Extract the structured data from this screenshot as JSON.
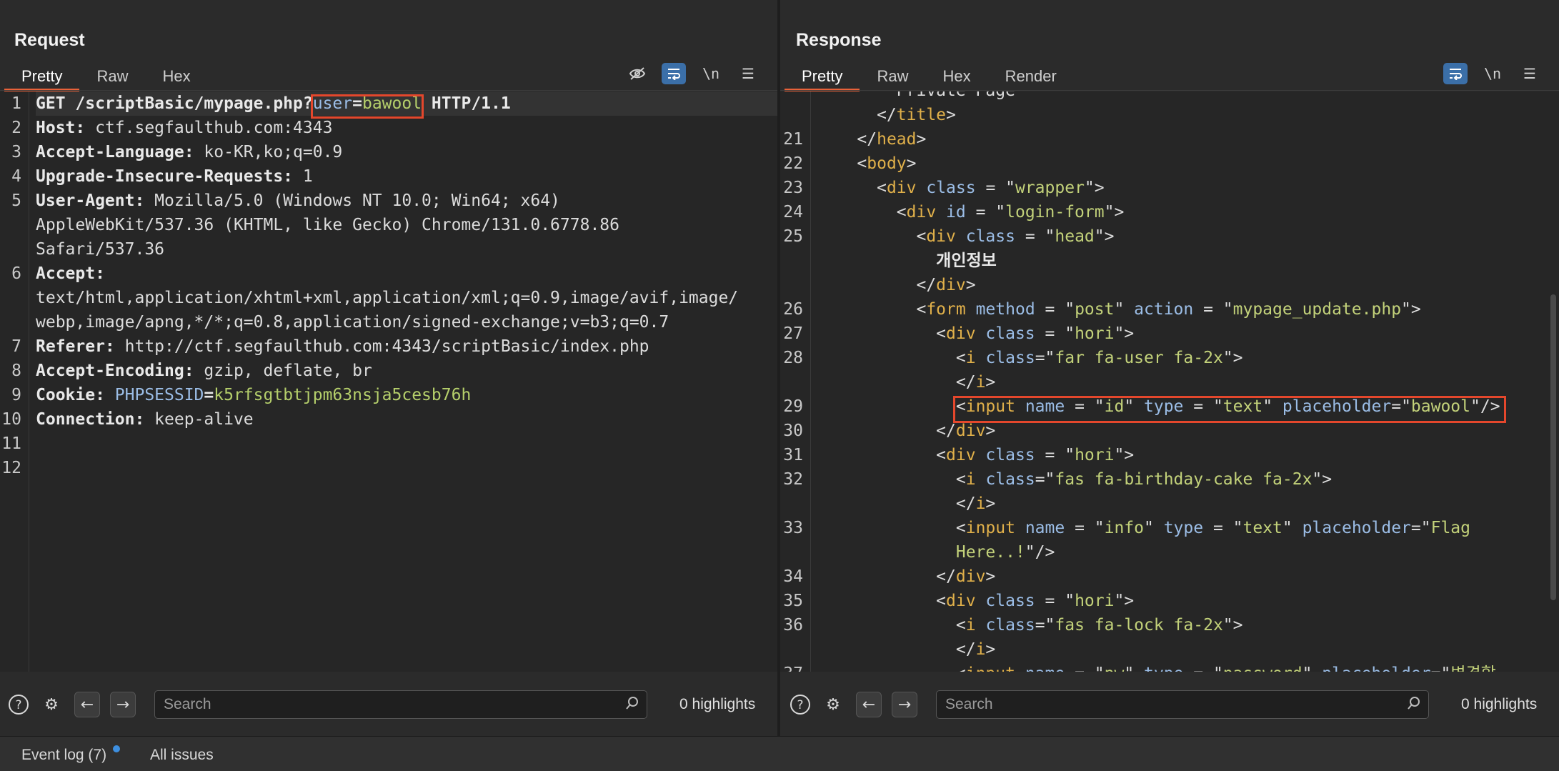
{
  "layout_buttons": [
    {
      "name": "split-horizontal",
      "active": true
    },
    {
      "name": "split-vertical",
      "active": false
    },
    {
      "name": "single-pane",
      "active": false
    }
  ],
  "request": {
    "title": "Request",
    "tabs": [
      "Pretty",
      "Raw",
      "Hex"
    ],
    "active_tab": "Pretty",
    "newline_label": "\\n",
    "lines": [
      {
        "n": "1",
        "segs": [
          [
            "k",
            "GET /scriptBasic/mypage.php?"
          ],
          [
            "p",
            "user"
          ],
          [
            "k",
            "="
          ],
          [
            "g",
            "bawool"
          ],
          [
            "k",
            " HTTP/1.1"
          ]
        ]
      },
      {
        "n": "2",
        "segs": [
          [
            "k",
            "Host: "
          ],
          [
            "",
            "ctf.segfaulthub.com:4343"
          ]
        ]
      },
      {
        "n": "3",
        "segs": [
          [
            "k",
            "Accept-Language: "
          ],
          [
            "",
            "ko-KR,ko;q=0.9"
          ]
        ]
      },
      {
        "n": "4",
        "segs": [
          [
            "k",
            "Upgrade-Insecure-Requests: "
          ],
          [
            "",
            "1"
          ]
        ]
      },
      {
        "n": "5",
        "segs": [
          [
            "k",
            "User-Agent: "
          ],
          [
            "",
            "Mozilla/5.0 (Windows NT 10.0; Win64; x64)"
          ]
        ]
      },
      {
        "n": "",
        "segs": [
          [
            "",
            "AppleWebKit/537.36 (KHTML, like Gecko) Chrome/131.0.6778.86"
          ]
        ]
      },
      {
        "n": "",
        "segs": [
          [
            "",
            "Safari/537.36"
          ]
        ]
      },
      {
        "n": "6",
        "segs": [
          [
            "k",
            "Accept:"
          ]
        ]
      },
      {
        "n": "",
        "segs": [
          [
            "",
            "text/html,application/xhtml+xml,application/xml;q=0.9,image/avif,image/"
          ]
        ]
      },
      {
        "n": "",
        "segs": [
          [
            "",
            "webp,image/apng,*/*;q=0.8,application/signed-exchange;v=b3;q=0.7"
          ]
        ]
      },
      {
        "n": "7",
        "segs": [
          [
            "k",
            "Referer: "
          ],
          [
            "",
            "http://ctf.segfaulthub.com:4343/scriptBasic/index.php"
          ]
        ]
      },
      {
        "n": "8",
        "segs": [
          [
            "k",
            "Accept-Encoding: "
          ],
          [
            "",
            "gzip, deflate, br"
          ]
        ]
      },
      {
        "n": "9",
        "segs": [
          [
            "k",
            "Cookie: "
          ],
          [
            "p",
            "PHPSESSID"
          ],
          [
            "k",
            "="
          ],
          [
            "g",
            "k5rfsgtbtjpm63nsja5cesb76h"
          ]
        ]
      },
      {
        "n": "10",
        "segs": [
          [
            "k",
            "Connection: "
          ],
          [
            "",
            "keep-alive"
          ]
        ]
      },
      {
        "n": "11",
        "segs": []
      },
      {
        "n": "12",
        "segs": []
      }
    ],
    "search_placeholder": "Search",
    "highlights": "0 highlights"
  },
  "response": {
    "title": "Response",
    "tabs": [
      "Pretty",
      "Raw",
      "Hex",
      "Render"
    ],
    "active_tab": "Pretty",
    "newline_label": "\\n",
    "lines": [
      {
        "n": "",
        "segs": [
          [
            "",
            "        Private Page"
          ]
        ]
      },
      {
        "n": "",
        "segs": [
          [
            "",
            "      </"
          ],
          [
            "t",
            "title"
          ],
          [
            "",
            ">"
          ]
        ]
      },
      {
        "n": "21",
        "segs": [
          [
            "",
            "    </"
          ],
          [
            "t",
            "head"
          ],
          [
            "",
            ">"
          ]
        ]
      },
      {
        "n": "22",
        "segs": [
          [
            "",
            "    <"
          ],
          [
            "t",
            "body"
          ],
          [
            "",
            ">"
          ]
        ]
      },
      {
        "n": "23",
        "segs": [
          [
            "",
            "      <"
          ],
          [
            "t",
            "div"
          ],
          [
            "",
            " "
          ],
          [
            "a",
            "class"
          ],
          [
            "",
            " = \""
          ],
          [
            "s",
            "wrapper"
          ],
          [
            "",
            "\">"
          ]
        ]
      },
      {
        "n": "24",
        "segs": [
          [
            "",
            "        <"
          ],
          [
            "t",
            "div"
          ],
          [
            "",
            " "
          ],
          [
            "a",
            "id"
          ],
          [
            "",
            " = \""
          ],
          [
            "s",
            "login-form"
          ],
          [
            "",
            "\">"
          ]
        ]
      },
      {
        "n": "25",
        "segs": [
          [
            "",
            "          <"
          ],
          [
            "t",
            "div"
          ],
          [
            "",
            " "
          ],
          [
            "a",
            "class"
          ],
          [
            "",
            " = \""
          ],
          [
            "s",
            "head"
          ],
          [
            "",
            "\">"
          ]
        ]
      },
      {
        "n": "",
        "segs": [
          [
            "k",
            "            개인정보"
          ]
        ]
      },
      {
        "n": "",
        "segs": [
          [
            "",
            "          </"
          ],
          [
            "t",
            "div"
          ],
          [
            "",
            ">"
          ]
        ]
      },
      {
        "n": "26",
        "segs": [
          [
            "",
            "          <"
          ],
          [
            "t",
            "form"
          ],
          [
            "",
            " "
          ],
          [
            "a",
            "method"
          ],
          [
            "",
            " = \""
          ],
          [
            "s",
            "post"
          ],
          [
            "",
            "\" "
          ],
          [
            "a",
            "action"
          ],
          [
            "",
            " = \""
          ],
          [
            "s",
            "mypage_update.php"
          ],
          [
            "",
            "\">"
          ]
        ]
      },
      {
        "n": "27",
        "segs": [
          [
            "",
            "            <"
          ],
          [
            "t",
            "div"
          ],
          [
            "",
            " "
          ],
          [
            "a",
            "class"
          ],
          [
            "",
            " = \""
          ],
          [
            "s",
            "hori"
          ],
          [
            "",
            "\">"
          ]
        ]
      },
      {
        "n": "28",
        "segs": [
          [
            "",
            "              <"
          ],
          [
            "t",
            "i"
          ],
          [
            "",
            " "
          ],
          [
            "a",
            "class"
          ],
          [
            "",
            "=\""
          ],
          [
            "s",
            "far fa-user fa-2x"
          ],
          [
            "",
            "\">"
          ]
        ]
      },
      {
        "n": "",
        "segs": [
          [
            "",
            "              </"
          ],
          [
            "t",
            "i"
          ],
          [
            "",
            ">"
          ]
        ]
      },
      {
        "n": "29",
        "segs": [
          [
            "",
            "              <"
          ],
          [
            "t",
            "input"
          ],
          [
            "",
            " "
          ],
          [
            "a",
            "name"
          ],
          [
            "",
            " = \""
          ],
          [
            "s",
            "id"
          ],
          [
            "",
            "\" "
          ],
          [
            "a",
            "type"
          ],
          [
            "",
            " = \""
          ],
          [
            "s",
            "text"
          ],
          [
            "",
            "\" "
          ],
          [
            "a",
            "placeholder"
          ],
          [
            "",
            "=\""
          ],
          [
            "s",
            "bawool"
          ],
          [
            "",
            "\"/>"
          ]
        ]
      },
      {
        "n": "30",
        "segs": [
          [
            "",
            "            </"
          ],
          [
            "t",
            "div"
          ],
          [
            "",
            ">"
          ]
        ]
      },
      {
        "n": "31",
        "segs": [
          [
            "",
            "            <"
          ],
          [
            "t",
            "div"
          ],
          [
            "",
            " "
          ],
          [
            "a",
            "class"
          ],
          [
            "",
            " = \""
          ],
          [
            "s",
            "hori"
          ],
          [
            "",
            "\">"
          ]
        ]
      },
      {
        "n": "32",
        "segs": [
          [
            "",
            "              <"
          ],
          [
            "t",
            "i"
          ],
          [
            "",
            " "
          ],
          [
            "a",
            "class"
          ],
          [
            "",
            "=\""
          ],
          [
            "s",
            "fas fa-birthday-cake fa-2x"
          ],
          [
            "",
            "\">"
          ]
        ]
      },
      {
        "n": "",
        "segs": [
          [
            "",
            "              </"
          ],
          [
            "t",
            "i"
          ],
          [
            "",
            ">"
          ]
        ]
      },
      {
        "n": "33",
        "segs": [
          [
            "",
            "              <"
          ],
          [
            "t",
            "input"
          ],
          [
            "",
            " "
          ],
          [
            "a",
            "name"
          ],
          [
            "",
            " = \""
          ],
          [
            "s",
            "info"
          ],
          [
            "",
            "\" "
          ],
          [
            "a",
            "type"
          ],
          [
            "",
            " = \""
          ],
          [
            "s",
            "text"
          ],
          [
            "",
            "\" "
          ],
          [
            "a",
            "placeholder"
          ],
          [
            "",
            "=\""
          ],
          [
            "s",
            "Flag"
          ]
        ]
      },
      {
        "n": "",
        "segs": [
          [
            "s",
            "              Here..!"
          ],
          [
            "",
            "\"/>"
          ]
        ]
      },
      {
        "n": "34",
        "segs": [
          [
            "",
            "            </"
          ],
          [
            "t",
            "div"
          ],
          [
            "",
            ">"
          ]
        ]
      },
      {
        "n": "35",
        "segs": [
          [
            "",
            "            <"
          ],
          [
            "t",
            "div"
          ],
          [
            "",
            " "
          ],
          [
            "a",
            "class"
          ],
          [
            "",
            " = \""
          ],
          [
            "s",
            "hori"
          ],
          [
            "",
            "\">"
          ]
        ]
      },
      {
        "n": "36",
        "segs": [
          [
            "",
            "              <"
          ],
          [
            "t",
            "i"
          ],
          [
            "",
            " "
          ],
          [
            "a",
            "class"
          ],
          [
            "",
            "=\""
          ],
          [
            "s",
            "fas fa-lock fa-2x"
          ],
          [
            "",
            "\">"
          ]
        ]
      },
      {
        "n": "",
        "segs": [
          [
            "",
            "              </"
          ],
          [
            "t",
            "i"
          ],
          [
            "",
            ">"
          ]
        ]
      },
      {
        "n": "37",
        "segs": [
          [
            "",
            "              <"
          ],
          [
            "t",
            "input"
          ],
          [
            "",
            " "
          ],
          [
            "a",
            "name"
          ],
          [
            "",
            " = \""
          ],
          [
            "s",
            "pw"
          ],
          [
            "",
            "\" "
          ],
          [
            "a",
            "type"
          ],
          [
            "",
            " = \""
          ],
          [
            "s",
            "password"
          ],
          [
            "",
            "\" "
          ],
          [
            "a",
            "placeholder"
          ],
          [
            "",
            "=\""
          ],
          [
            "s",
            "변경할"
          ]
        ]
      }
    ],
    "search_placeholder": "Search",
    "highlights": "0 highlights"
  },
  "statusbar": {
    "event_log": "Event log (7)",
    "all_issues": "All issues"
  },
  "colors": {
    "accent_tab": "#e8623a",
    "highlight_box": "#e4472c",
    "toggle_blue": "#3b6fa8"
  }
}
